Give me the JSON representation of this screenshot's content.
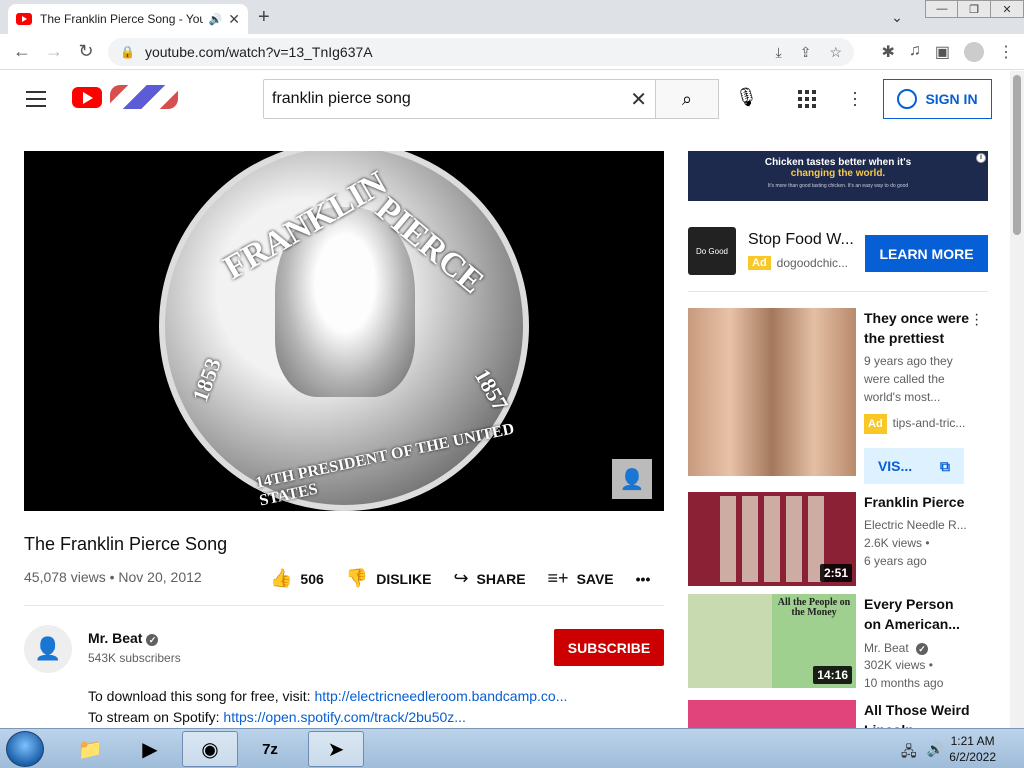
{
  "browser": {
    "tab_title": "The Franklin Pierce Song - YouTube",
    "url": "youtube.com/watch?v=13_TnIg637A"
  },
  "youtube": {
    "search_value": "franklin pierce song",
    "sign_in": "SIGN IN"
  },
  "video": {
    "coin_text_1": "FRANKLIN",
    "coin_text_2": "PIERCE",
    "coin_text_3": "1853",
    "coin_text_4": "1857",
    "coin_text_5": "14TH PRESIDENT OF THE UNITED STATES",
    "title": "The Franklin Pierce Song",
    "meta": "45,078 views • Nov 20, 2012",
    "likes": "506",
    "dislike": "DISLIKE",
    "share": "SHARE",
    "save": "SAVE"
  },
  "channel": {
    "name": "Mr. Beat",
    "subscribers": "543K subscribers",
    "subscribe": "SUBSCRIBE"
  },
  "description": {
    "line1_text": "To download this song for free, visit: ",
    "line1_link": "http://electricneedleroom.bandcamp.co...",
    "line2_text": "To stream on Spotify: ",
    "line2_link": "https://open.spotify.com/track/2bu50z..."
  },
  "ad_banner": {
    "line1": "Chicken tastes better when it's",
    "line2": "changing the world.",
    "small": "It's more than good tasting chicken. It's an easy way to do good"
  },
  "ad": {
    "logo_text": "Do Good",
    "title": "Stop Food W...",
    "badge": "Ad",
    "source": "dogoodchic...",
    "cta": "LEARN MORE"
  },
  "recommendations": [
    {
      "title": "They once were the prettiest",
      "line1": "9 years ago they",
      "line2": "were called the",
      "line3": "world's most...",
      "badge": "Ad",
      "source": "tips-and-tric...",
      "visit": "VIS..."
    },
    {
      "title": "Franklin Pierce",
      "channel": "Electric Needle R...",
      "views": "2.6K views •",
      "age": "6 years ago",
      "duration": "2:51"
    },
    {
      "title": "Every Person on American...",
      "channel": "Mr. Beat",
      "views": "302K views •",
      "age": "10 months ago",
      "duration": "14:16",
      "thumb_caption": "All the People on the Money"
    },
    {
      "title": "All Those Weird Lincoln..."
    }
  ],
  "taskbar": {
    "time": "1:21 AM",
    "date": "6/2/2022",
    "zip_label": "7z"
  }
}
